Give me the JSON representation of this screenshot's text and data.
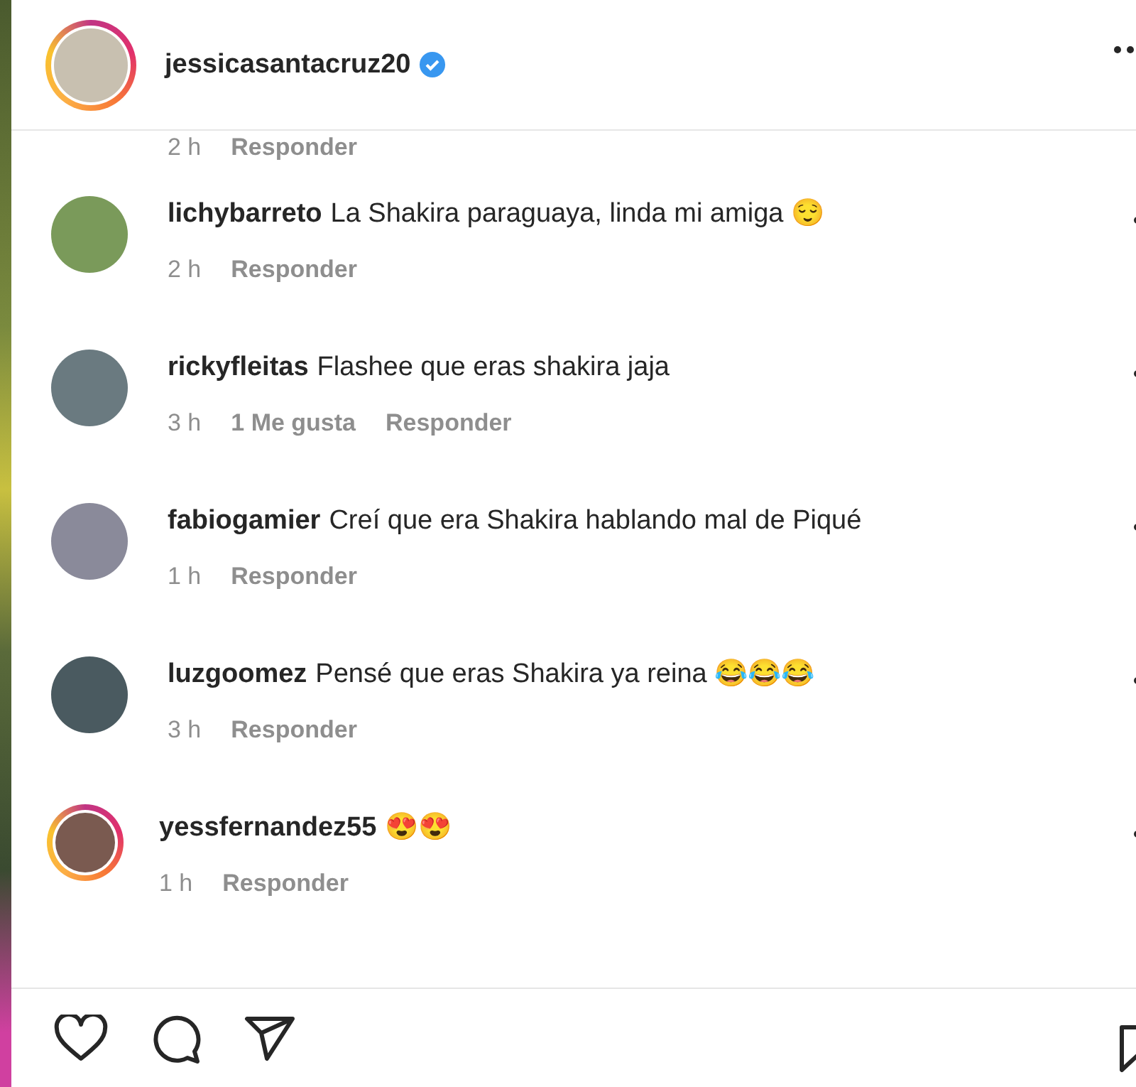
{
  "header": {
    "username": "jessicasantacruz20",
    "verified": true
  },
  "partial_comment": {
    "time": "2 h",
    "reply": "Responder"
  },
  "comments": [
    {
      "username": "lichybarreto",
      "text": "La Shakira paraguaya, linda mi amiga 😌",
      "time": "2 h",
      "reply": "Responder",
      "story_ring": false
    },
    {
      "username": "rickyfleitas",
      "text": "Flashee que eras shakira jaja",
      "time": "3 h",
      "likes": "1 Me gusta",
      "reply": "Responder",
      "story_ring": false
    },
    {
      "username": "fabiogamier",
      "text": "Creí que era Shakira hablando mal de Piqué",
      "time": "1 h",
      "reply": "Responder",
      "story_ring": false
    },
    {
      "username": "luzgoomez",
      "text": "Pensé que eras Shakira ya reina 😂😂😂",
      "time": "3 h",
      "reply": "Responder",
      "story_ring": false
    },
    {
      "username": "yessfernandez55",
      "text": "😍😍",
      "time": "1 h",
      "reply": "Responder",
      "story_ring": true
    }
  ]
}
